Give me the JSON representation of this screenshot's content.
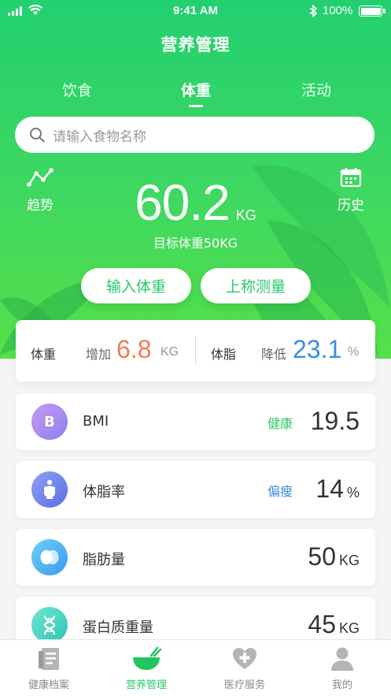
{
  "status_bar": {
    "time": "9:41 AM",
    "battery": "100%"
  },
  "title": "营养管理",
  "tabs": [
    {
      "label": "饮食"
    },
    {
      "label": "体重"
    },
    {
      "label": "活动"
    }
  ],
  "search": {
    "placeholder": "请输入食物名称",
    "icon": "search-icon"
  },
  "trend_button": {
    "label": "趋势",
    "icon": "trend-icon"
  },
  "history_button": {
    "label": "历史",
    "icon": "calendar-icon"
  },
  "weight": {
    "value": "60.2",
    "unit": "KG",
    "target": "目标体重50KG"
  },
  "actions": {
    "input_weight": "输入体重",
    "scale_measure": "上称测量"
  },
  "summary": {
    "weight_label": "体重",
    "weight_change_label": "增加",
    "weight_change_value": "6.8",
    "weight_change_unit": "KG",
    "fat_label": "体脂",
    "fat_change_label": "降低",
    "fat_change_value": "23.1",
    "fat_change_unit": "%"
  },
  "metrics": [
    {
      "name": "BMI",
      "icon_text": "B",
      "icon": "bmi-icon",
      "status": "健康",
      "status_color": "#2bc86a",
      "value": "19.5",
      "unit": ""
    },
    {
      "name": "体脂率",
      "icon": "body-icon",
      "status": "偏瘦",
      "status_color": "#3a8ee6",
      "value": "14",
      "unit": "%"
    },
    {
      "name": "脂肪量",
      "icon": "fat-drop-icon",
      "status": "",
      "value": "50",
      "unit": "KG"
    },
    {
      "name": "蛋白质重量",
      "icon": "dna-icon",
      "status": "",
      "value": "45",
      "unit": "KG"
    }
  ],
  "tabbar": [
    {
      "label": "健康档案",
      "icon": "records-icon"
    },
    {
      "label": "营养管理",
      "icon": "bowl-icon"
    },
    {
      "label": "医疗服务",
      "icon": "medical-heart-icon"
    },
    {
      "label": "我的",
      "icon": "user-icon"
    }
  ],
  "colors": {
    "accent": "#2bc86a",
    "increase": "#f07a55",
    "decrease": "#3a8ee6"
  }
}
